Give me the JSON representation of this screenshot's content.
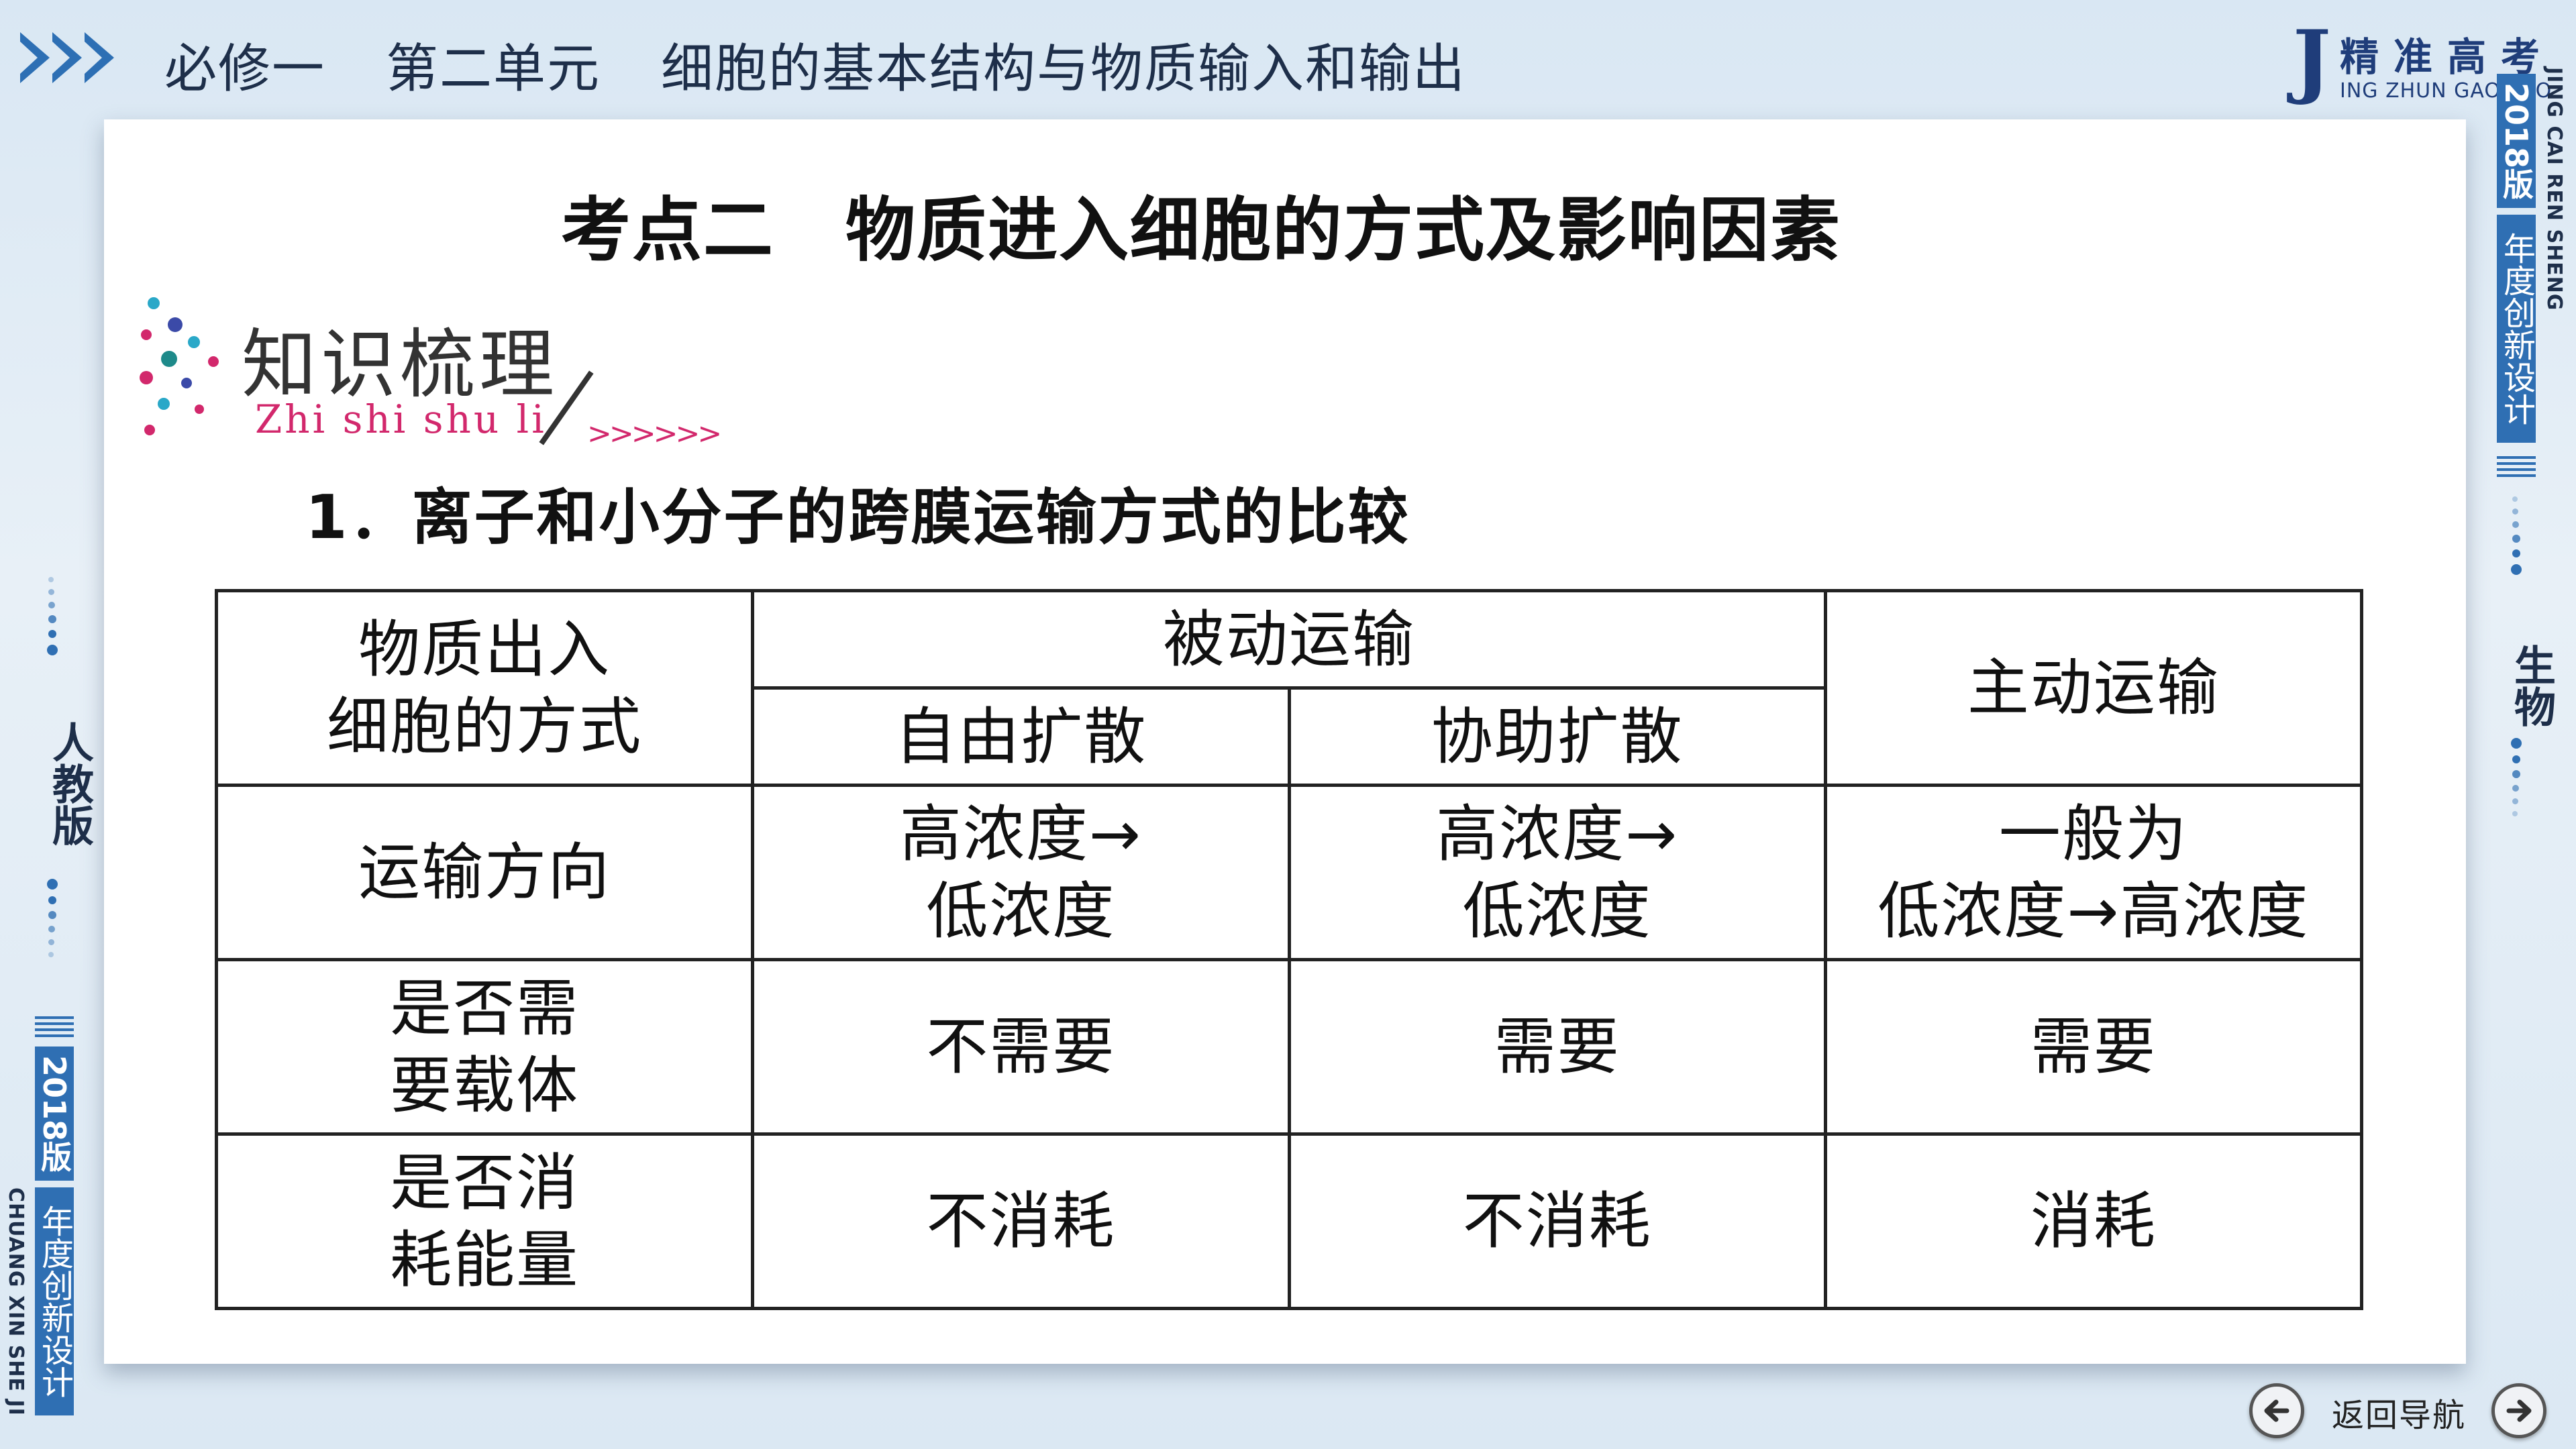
{
  "header": {
    "breadcrumb": [
      "必修一",
      "第二单元",
      "细胞的基本结构与物质输入和输出"
    ],
    "brand_cn": "精准高考",
    "brand_letter": "J",
    "brand_en": "ING ZHUN GAO KAO"
  },
  "right_sidebar": {
    "vertical_en": "JING CAI REN SHENG",
    "year_badge": "2018版",
    "badge_text": "年度创新设计",
    "subject": "生物"
  },
  "left_sidebar": {
    "edition": "人教版",
    "year_badge": "2018版",
    "badge_text": "年度创新设计",
    "vertical_en": "CHUANG XIN SHE JI"
  },
  "main": {
    "title": "考点二　物质进入细胞的方式及影响因素",
    "section_logo_cn": "知识梳理",
    "section_logo_en": "Zhi shi shu li",
    "section_logo_arrows": ">>>>>>",
    "subheading": "1．离子和小分子的跨膜运输方式的比较"
  },
  "table": {
    "corner": [
      "物质出入",
      "细胞的方式"
    ],
    "passive": "被动运输",
    "free_diffusion": "自由扩散",
    "facilitated": "协助扩散",
    "active": "主动运输",
    "rows": [
      {
        "label": [
          "运输方向"
        ],
        "free": [
          "高浓度→",
          "低浓度"
        ],
        "facilitated": [
          "高浓度→",
          "低浓度"
        ],
        "active": [
          "一般为",
          "低浓度→高浓度"
        ]
      },
      {
        "label": [
          "是否需",
          "要载体"
        ],
        "free": [
          "不需要"
        ],
        "facilitated": [
          "需要"
        ],
        "active": [
          "需要"
        ]
      },
      {
        "label": [
          "是否消",
          "耗能量"
        ],
        "free": [
          "不消耗"
        ],
        "facilitated": [
          "不消耗"
        ],
        "active": [
          "消耗"
        ]
      }
    ]
  },
  "nav": {
    "label": "返回导航",
    "prev_icon": "arrow-left-icon",
    "next_icon": "arrow-right-icon"
  },
  "colors": {
    "accent": "#2f6fb3",
    "logo_pink": "#d2286c",
    "background": "#dbe8f3"
  }
}
